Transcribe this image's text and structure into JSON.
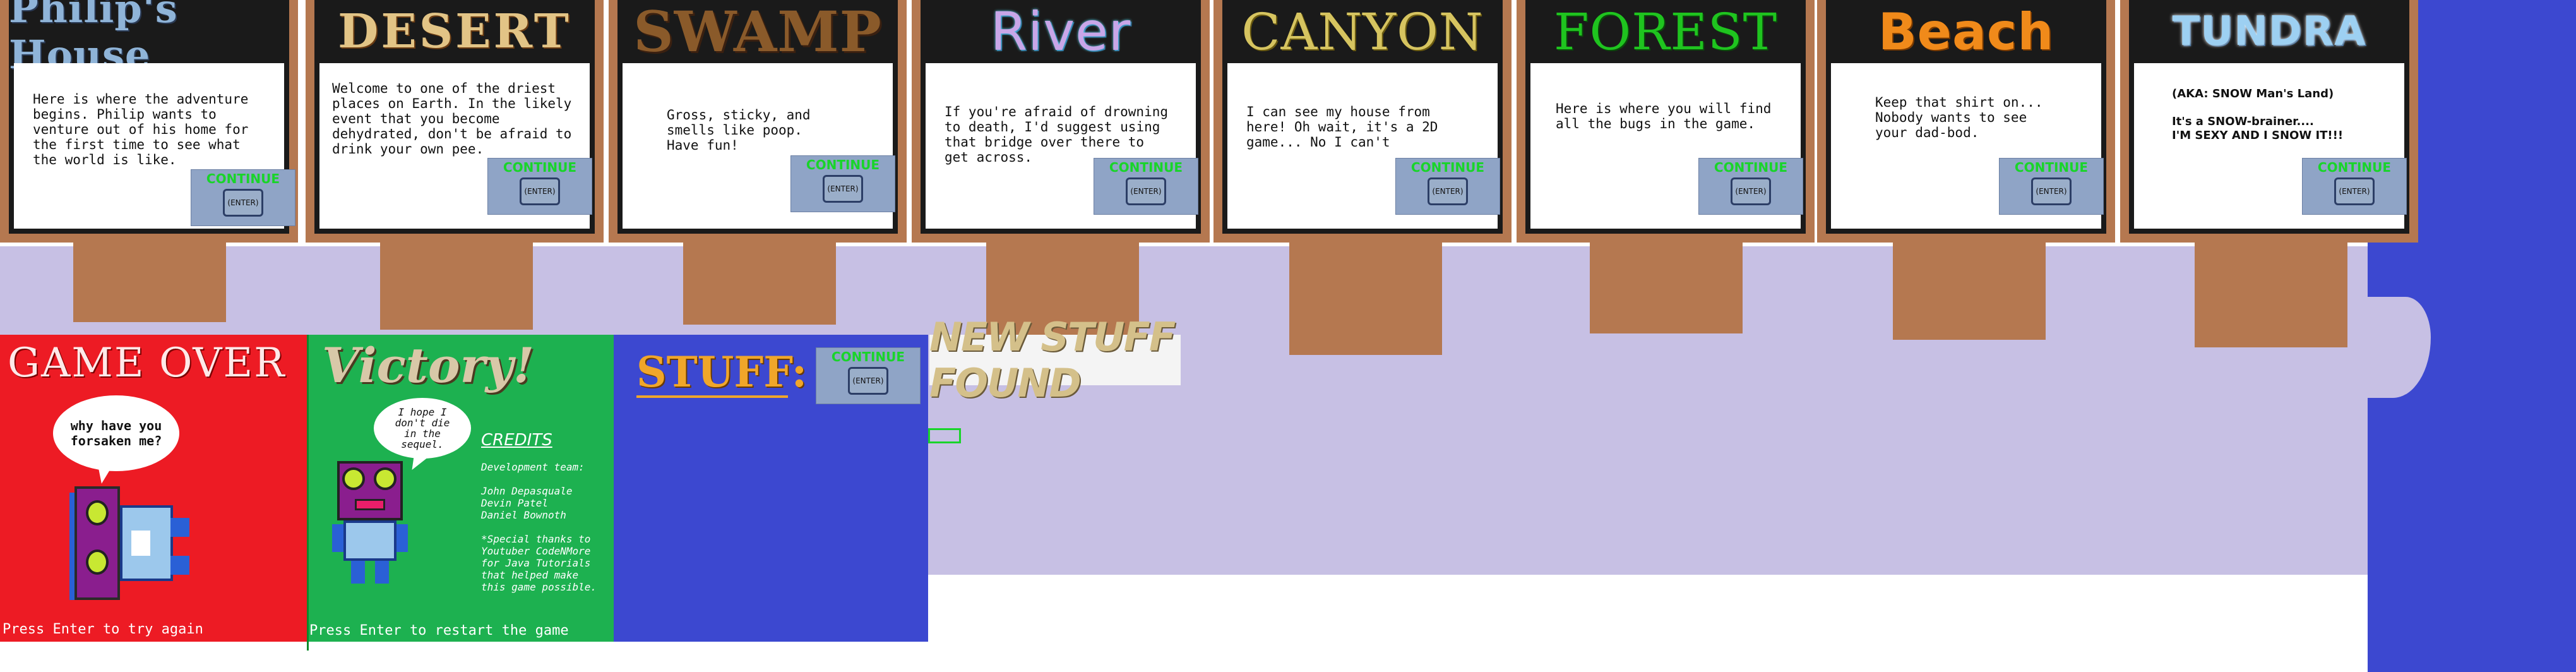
{
  "signs": [
    {
      "title": "Philip's House",
      "desc": "Here is where the adventure\nbegins. Philip wants to\nventure out of his home for\nthe first time to see what\nthe world is like.",
      "title_color": "#8fb4d8"
    },
    {
      "title": "DESERT",
      "desc": "Welcome to one of the driest\nplaces on Earth. In the likely\nevent that you become\ndehydrated, don't be afraid to\ndrink your own pee.",
      "title_color": "#e2c486"
    },
    {
      "title": "SWAMP",
      "desc": "Gross, sticky, and\nsmells like poop.\nHave fun!",
      "title_color": "#8a5a2a"
    },
    {
      "title": "River",
      "desc": "If you're afraid of drowning\nto death, I'd suggest using\nthat bridge over there to\nget across.",
      "title_color": "#c9a6e8"
    },
    {
      "title": "CANYON",
      "desc": "I can see my house from\nhere! Oh wait, it's a 2D\ngame... No I can't",
      "title_color": "#d6c460"
    },
    {
      "title": "FOREST",
      "desc": "Here is where you will find\nall the bugs in the game.",
      "title_color": "#1fc41f"
    },
    {
      "title": "Beach",
      "desc": "Keep that shirt on...\nNobody wants to see\nyour dad-bod.",
      "title_color": "#f08a1a"
    },
    {
      "title": "TUNDRA",
      "desc": "(AKA: SNOW Man's Land)\n\nIt's a SNOW-brainer....\nI'M SEXY AND I SNOW IT!!!",
      "title_color": "#9dd0f2"
    }
  ],
  "continue_label": "CONTINUE",
  "enter_label": "(ENTER)",
  "gameover": {
    "title": "GAME OVER",
    "bubble": "why have you\nforsaken me?",
    "footer": "Press Enter to try again"
  },
  "victory": {
    "title": "Victory!",
    "bubble": "I hope I\ndon't die\nin the\nsequel.",
    "credits_title": "CREDITS",
    "credits_body": "Development team:\n\nJohn Depasquale\nDevin Patel\nDaniel Bownoth\n\n*Special thanks to\nYoutuber CodeNMore\nfor Java Tutorials\nthat helped make\nthis game possible.",
    "footer": "Press Enter to restart the game"
  },
  "stuff": {
    "title": "STUFF:"
  },
  "new_stuff_found": "NEW STUFF FOUND",
  "colors": {
    "wood": "#b57850",
    "lavender": "#c7c0e4",
    "blue": "#3c48d0",
    "red": "#ed1b24",
    "green": "#1db150",
    "continue_green": "#19d42a"
  }
}
